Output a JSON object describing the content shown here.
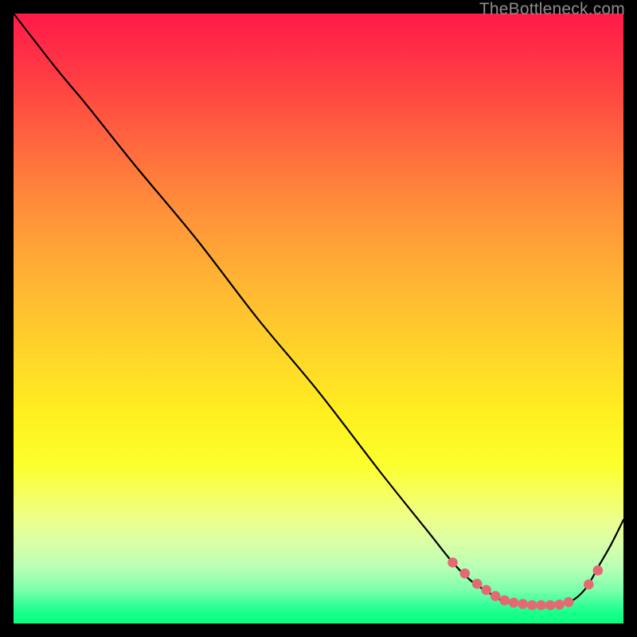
{
  "watermark": "TheBottleneck.com",
  "colors": {
    "curve": "#000000",
    "marker_fill": "#e46a72",
    "marker_stroke": "#d95965"
  },
  "chart_data": {
    "type": "line",
    "title": "",
    "xlabel": "",
    "ylabel": "",
    "xlim": [
      0,
      100
    ],
    "ylim": [
      0,
      100
    ],
    "series": [
      {
        "name": "curve",
        "x": [
          0,
          7,
          12,
          20,
          30,
          40,
          50,
          60,
          68,
          72,
          75,
          78,
          80,
          82,
          84,
          86,
          88,
          90,
          92,
          94,
          96,
          98,
          100
        ],
        "y": [
          100,
          91,
          85,
          75,
          63,
          50,
          38,
          25,
          15,
          10,
          7,
          5,
          3.8,
          3.2,
          3.0,
          3.0,
          3.0,
          3.2,
          4.0,
          6.0,
          9.5,
          13,
          17
        ]
      }
    ],
    "markers": {
      "comment": "flat-bottom cluster and two right-rise points",
      "x": [
        72,
        74,
        76,
        77.5,
        79,
        80.5,
        82,
        83.5,
        85,
        86.5,
        88,
        89.5,
        91,
        94.3,
        95.8
      ],
      "y": [
        10,
        8.2,
        6.5,
        5.5,
        4.5,
        3.8,
        3.4,
        3.2,
        3.0,
        3.0,
        3.0,
        3.1,
        3.5,
        6.4,
        8.7
      ]
    }
  }
}
